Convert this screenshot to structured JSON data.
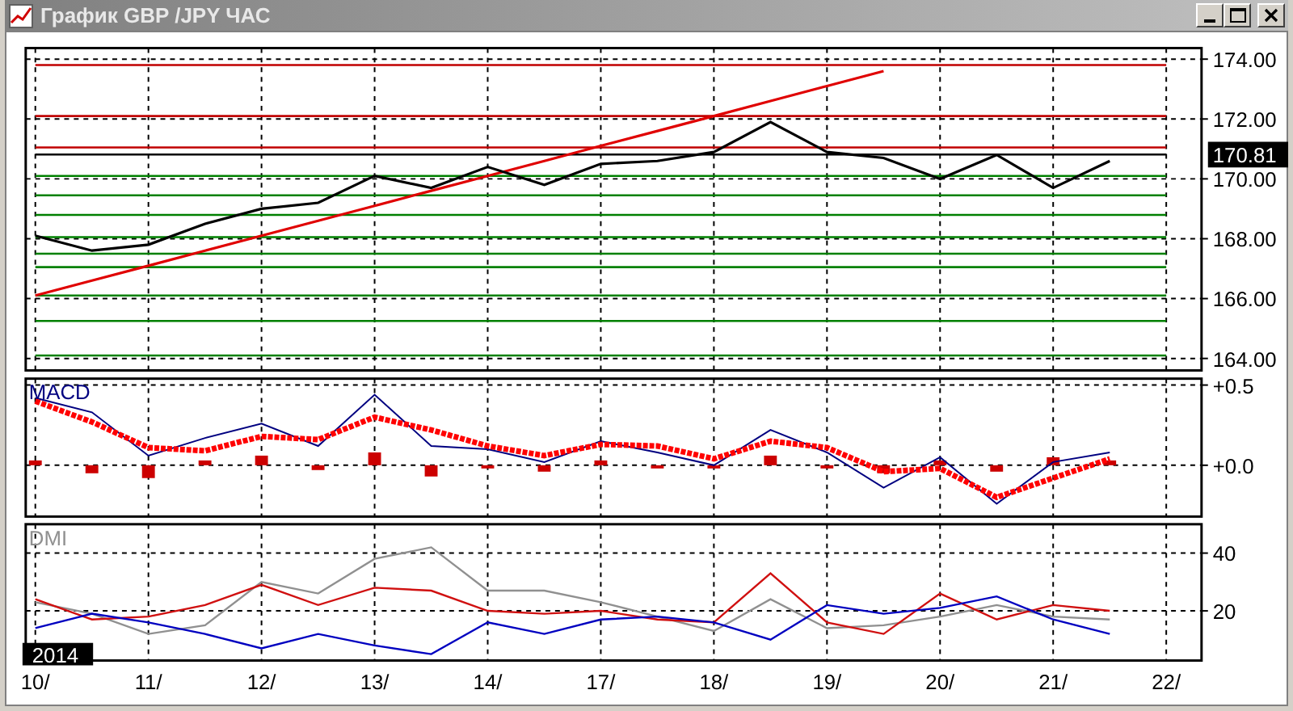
{
  "window": {
    "title": "График GBP /JPY  ЧАС"
  },
  "price_panel": {
    "current_price": "170.81",
    "chart_data": {
      "type": "line",
      "grid": true,
      "categories": [
        null,
        null,
        null,
        null,
        null,
        null,
        null,
        null,
        null,
        null,
        null,
        null,
        null,
        null,
        null,
        null,
        null,
        null,
        null,
        null,
        null
      ],
      "series": [
        {
          "color": "#c00000",
          "values": [
            173.8,
            173.8,
            173.8,
            173.8,
            173.8,
            173.8,
            173.8,
            173.8,
            173.8,
            173.8,
            173.8,
            173.8,
            173.8,
            173.8,
            173.8,
            173.8,
            173.8,
            173.8,
            173.8,
            173.8,
            173.8
          ]
        },
        {
          "color": "#c00000",
          "values": [
            172.1,
            172.1,
            172.1,
            172.1,
            172.1,
            172.1,
            172.1,
            172.1,
            172.1,
            172.1,
            172.1,
            172.1,
            172.1,
            172.1,
            172.1,
            172.1,
            172.1,
            172.1,
            172.1,
            172.1,
            172.1
          ]
        },
        {
          "color": "#c00000",
          "values": [
            171.05,
            171.05,
            171.05,
            171.05,
            171.05,
            171.05,
            171.05,
            171.05,
            171.05,
            171.05,
            171.05,
            171.05,
            171.05,
            171.05,
            171.05,
            171.05,
            171.05,
            171.05,
            171.05,
            171.05,
            171.05
          ]
        },
        {
          "color": "#000000",
          "values": [
            170.81,
            170.81,
            170.81,
            170.81,
            170.81,
            170.81,
            170.81,
            170.81,
            170.81,
            170.81,
            170.81,
            170.81,
            170.81,
            170.81,
            170.81,
            170.81,
            170.81,
            170.81,
            170.81,
            170.81,
            170.81
          ]
        },
        {
          "color": "#008000",
          "values": [
            170.1,
            170.1,
            170.1,
            170.1,
            170.1,
            170.1,
            170.1,
            170.1,
            170.1,
            170.1,
            170.1,
            170.1,
            170.1,
            170.1,
            170.1,
            170.1,
            170.1,
            170.1,
            170.1,
            170.1,
            170.1
          ]
        },
        {
          "color": "#008000",
          "values": [
            169.45,
            169.45,
            169.45,
            169.45,
            169.45,
            169.45,
            169.45,
            169.45,
            169.45,
            169.45,
            169.45,
            169.45,
            169.45,
            169.45,
            169.45,
            169.45,
            169.45,
            169.45,
            169.45,
            169.45,
            169.45
          ]
        },
        {
          "color": "#008000",
          "values": [
            168.8,
            168.8,
            168.8,
            168.8,
            168.8,
            168.8,
            168.8,
            168.8,
            168.8,
            168.8,
            168.8,
            168.8,
            168.8,
            168.8,
            168.8,
            168.8,
            168.8,
            168.8,
            168.8,
            168.8,
            168.8
          ]
        },
        {
          "color": "#008000",
          "values": [
            168.05,
            168.05,
            168.05,
            168.05,
            168.05,
            168.05,
            168.05,
            168.05,
            168.05,
            168.05,
            168.05,
            168.05,
            168.05,
            168.05,
            168.05,
            168.05,
            168.05,
            168.05,
            168.05,
            168.05,
            168.05
          ]
        },
        {
          "color": "#008000",
          "values": [
            167.5,
            167.5,
            167.5,
            167.5,
            167.5,
            167.5,
            167.5,
            167.5,
            167.5,
            167.5,
            167.5,
            167.5,
            167.5,
            167.5,
            167.5,
            167.5,
            167.5,
            167.5,
            167.5,
            167.5,
            167.5
          ]
        },
        {
          "color": "#008000",
          "values": [
            167.05,
            167.05,
            167.05,
            167.05,
            167.05,
            167.05,
            167.05,
            167.05,
            167.05,
            167.05,
            167.05,
            167.05,
            167.05,
            167.05,
            167.05,
            167.05,
            167.05,
            167.05,
            167.05,
            167.05,
            167.05
          ]
        },
        {
          "color": "#008000",
          "values": [
            166.1,
            166.1,
            166.1,
            166.1,
            166.1,
            166.1,
            166.1,
            166.1,
            166.1,
            166.1,
            166.1,
            166.1,
            166.1,
            166.1,
            166.1,
            166.1,
            166.1,
            166.1,
            166.1,
            166.1,
            166.1
          ]
        },
        {
          "color": "#008000",
          "values": [
            165.25,
            165.25,
            165.25,
            165.25,
            165.25,
            165.25,
            165.25,
            165.25,
            165.25,
            165.25,
            165.25,
            165.25,
            165.25,
            165.25,
            165.25,
            165.25,
            165.25,
            165.25,
            165.25,
            165.25,
            165.25
          ]
        },
        {
          "color": "#008000",
          "values": [
            164.1,
            164.1,
            164.1,
            164.1,
            164.1,
            164.1,
            164.1,
            164.1,
            164.1,
            164.1,
            164.1,
            164.1,
            164.1,
            164.1,
            164.1,
            164.1,
            164.1,
            164.1,
            164.1,
            164.1,
            164.1
          ]
        },
        {
          "color": "#e00000",
          "values": [
            166.1,
            166.6,
            167.1,
            167.6,
            168.1,
            168.6,
            169.1,
            169.6,
            170.1,
            170.6,
            171.1,
            171.6,
            172.1,
            172.6,
            173.1,
            173.6,
            null,
            null,
            null,
            null,
            null
          ]
        },
        {
          "color": "#000000",
          "values": [
            168.1,
            167.6,
            167.8,
            168.5,
            169.0,
            169.2,
            170.1,
            169.7,
            170.4,
            169.8,
            170.5,
            170.6,
            170.9,
            171.9,
            170.9,
            170.7,
            170.0,
            170.8,
            169.7,
            170.6,
            null
          ]
        }
      ],
      "ylim": [
        163.6,
        174.37
      ],
      "yticks": [
        {
          "value": 174,
          "label": "174.00"
        },
        {
          "value": 172,
          "label": "172.00"
        },
        {
          "value": 170,
          "label": "170.00"
        },
        {
          "value": 168,
          "label": "168.00"
        },
        {
          "value": 166,
          "label": "166.00"
        },
        {
          "value": 164,
          "label": "164.00"
        }
      ]
    }
  },
  "macd_panel": {
    "label": "MACD",
    "chart_data": {
      "type": "line",
      "grid": true,
      "categories": [
        null,
        null,
        null,
        null,
        null,
        null,
        null,
        null,
        null,
        null,
        null,
        null,
        null,
        null,
        null,
        null,
        null,
        null,
        null,
        null,
        null
      ],
      "series": [
        {
          "type": "bar",
          "color": "#cc0000",
          "values": [
            0.03,
            -0.05,
            -0.08,
            0.03,
            0.06,
            -0.03,
            0.08,
            -0.07,
            -0.02,
            -0.04,
            0.03,
            -0.02,
            -0.02,
            0.06,
            -0.02,
            -0.05,
            0.03,
            -0.04,
            0.05,
            0.03,
            null
          ]
        },
        {
          "type": "line",
          "color": "#000080",
          "values": [
            0.42,
            0.33,
            0.06,
            0.17,
            0.26,
            0.12,
            0.44,
            0.12,
            0.1,
            0.02,
            0.15,
            0.08,
            0.0,
            0.22,
            0.08,
            -0.14,
            0.05,
            -0.24,
            0.02,
            0.08,
            null
          ]
        },
        {
          "type": "line",
          "color": "#ff0000",
          "line_style": "dashed",
          "values": [
            0.4,
            0.27,
            0.11,
            0.09,
            0.18,
            0.16,
            0.3,
            0.22,
            0.12,
            0.06,
            0.13,
            0.12,
            0.04,
            0.15,
            0.11,
            -0.04,
            -0.02,
            -0.2,
            -0.08,
            0.04,
            null
          ]
        }
      ],
      "ylim": [
        -0.32,
        0.54
      ],
      "yticks": [
        {
          "value": 0.5,
          "label": "+0.5"
        },
        {
          "value": 0,
          "label": "+0.0"
        }
      ]
    }
  },
  "dmi_panel": {
    "label": "DMI",
    "year": "2014",
    "chart_data": {
      "type": "line",
      "grid": true,
      "categories": [
        "10/",
        null,
        "11/",
        null,
        "12/",
        null,
        "13/",
        null,
        "14/",
        null,
        "17/",
        null,
        "18/",
        null,
        "19/",
        null,
        "20/",
        null,
        "21/",
        null,
        "22/"
      ],
      "series": [
        {
          "color": "#909090",
          "values": [
            23,
            19,
            12,
            15,
            30,
            26,
            38,
            42,
            27,
            27,
            23,
            18,
            13,
            24,
            14,
            15,
            18,
            22,
            18,
            17,
            null
          ]
        },
        {
          "color": "#d01010",
          "values": [
            24,
            17,
            18,
            22,
            29,
            22,
            28,
            27,
            20,
            19,
            20,
            17,
            16,
            33,
            16,
            12,
            26,
            17,
            22,
            20,
            null
          ]
        },
        {
          "color": "#0000c0",
          "values": [
            14,
            19,
            16,
            12,
            7,
            12,
            8,
            5,
            16,
            12,
            17,
            18,
            16,
            10,
            22,
            19,
            21,
            25,
            17,
            12,
            null
          ]
        }
      ],
      "ylim": [
        2.8,
        50
      ],
      "yticks": [
        {
          "value": 40,
          "label": "40"
        },
        {
          "value": 20,
          "label": "20"
        }
      ]
    }
  }
}
